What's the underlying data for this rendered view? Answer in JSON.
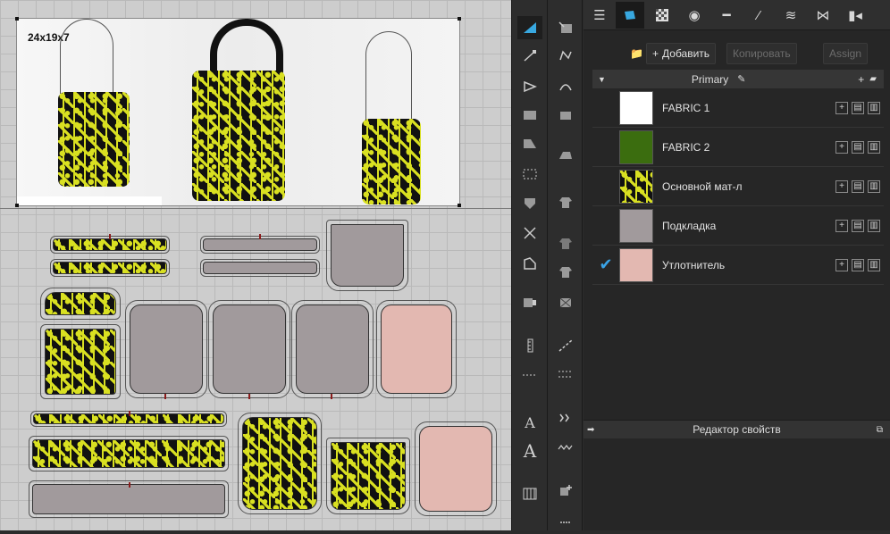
{
  "canvas": {
    "size_label": "24x19x7",
    "colors": {
      "background": "#cdcdcd",
      "grid": "#b9b9b9",
      "lining": "#a19a9c",
      "interfacing": "#e3b8b1",
      "pattern_ink": "#d9e021"
    }
  },
  "toolbar_left": {
    "tools": [
      {
        "icon": "select-icon"
      },
      {
        "icon": "edit-point-icon"
      },
      {
        "icon": "transform-icon"
      },
      {
        "icon": "rectangle-icon"
      },
      {
        "icon": "polygon-icon"
      },
      {
        "icon": "internal-rect-icon"
      },
      {
        "icon": "fold-icon"
      },
      {
        "icon": "cut-icon"
      },
      {
        "icon": "dart-icon"
      },
      {
        "icon": "puckering-icon"
      },
      {
        "icon": "ruler-icon"
      },
      {
        "icon": "seam-line-icon"
      },
      {
        "icon": "text-icon",
        "glyph": "A"
      },
      {
        "icon": "text-outline-icon",
        "glyph": "A"
      },
      {
        "icon": "grid-icon"
      }
    ]
  },
  "toolbar_right": {
    "tools": [
      {
        "icon": "segment-sewing-icon"
      },
      {
        "icon": "free-sewing-icon"
      },
      {
        "icon": "m-n-sewing-icon"
      },
      {
        "icon": "check-sewing-icon"
      },
      {
        "icon": "iron-icon"
      },
      {
        "icon": "shirt-icon"
      },
      {
        "icon": "select-mesh-icon"
      },
      {
        "icon": "pin-icon"
      },
      {
        "icon": "fabric-icon"
      },
      {
        "icon": "zoom-line-icon"
      },
      {
        "icon": "measure-icon"
      },
      {
        "icon": "stitch-icon"
      },
      {
        "icon": "topstitch-icon"
      },
      {
        "icon": "trim-icon"
      },
      {
        "icon": "zipper-icon"
      }
    ]
  },
  "tabs": [
    {
      "icon": "list-icon"
    },
    {
      "icon": "fabric-icon",
      "active": true
    },
    {
      "icon": "checker-icon"
    },
    {
      "icon": "button-icon"
    },
    {
      "icon": "line-icon"
    },
    {
      "icon": "stitch-icon"
    },
    {
      "icon": "zigzag-icon"
    },
    {
      "icon": "bow-icon"
    },
    {
      "icon": "more-icon"
    }
  ],
  "actions": {
    "add_folder_icon": "folder-add-icon",
    "add_label": "Добавить",
    "copy_label": "Копировать",
    "assign_label": "Assign"
  },
  "section": {
    "title": "Primary",
    "edit_icon": "pencil-icon",
    "add_icon": "plus-icon",
    "folder_icon": "folder-icon"
  },
  "materials": [
    {
      "name": "FABRIC 1",
      "color": "#ffffff",
      "checked": false
    },
    {
      "name": "FABRIC 2",
      "color": "#3b6d0f",
      "checked": false
    },
    {
      "name": "Основной мат-л",
      "color": "pattern",
      "checked": false
    },
    {
      "name": "Подкладка",
      "color": "#a19a9c",
      "checked": false
    },
    {
      "name": "Утлотнитель",
      "color": "#e3b8b1",
      "checked": true,
      "check_mark": "✔"
    }
  ],
  "properties": {
    "title": "Редактор свойств",
    "icon": "popout-icon"
  },
  "accent": "#38a8e0"
}
